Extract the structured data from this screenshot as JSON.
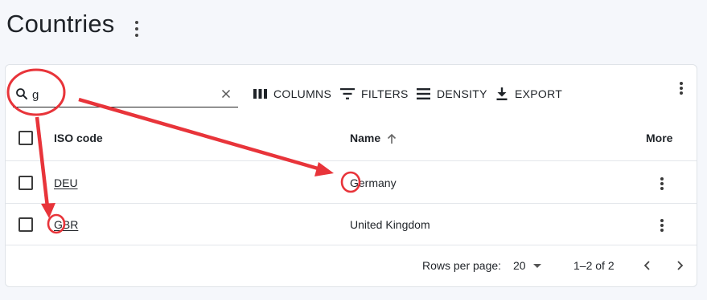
{
  "page": {
    "title": "Countries"
  },
  "toolbar": {
    "search_value": "g",
    "columns_label": "COLUMNS",
    "filters_label": "FILTERS",
    "density_label": "DENSITY",
    "export_label": "EXPORT"
  },
  "table": {
    "headers": {
      "iso": "ISO code",
      "name": "Name",
      "more": "More"
    },
    "sort": {
      "column": "name",
      "direction": "asc"
    },
    "rows": [
      {
        "iso": "DEU",
        "name": "Germany"
      },
      {
        "iso": "GBR",
        "name": "United Kingdom"
      }
    ]
  },
  "footer": {
    "rows_per_page_label": "Rows per page:",
    "rows_per_page_value": "20",
    "range": "1–2 of 2"
  },
  "colors": {
    "annotation": "#e8343a",
    "background": "#f5f7fb"
  },
  "icons": [
    "more-vert-icon",
    "search-icon",
    "clear-icon",
    "columns-icon",
    "filter-icon",
    "density-icon",
    "export-icon",
    "sort-arrow-up-icon",
    "chevron-left-icon",
    "chevron-right-icon",
    "caret-down-icon"
  ]
}
